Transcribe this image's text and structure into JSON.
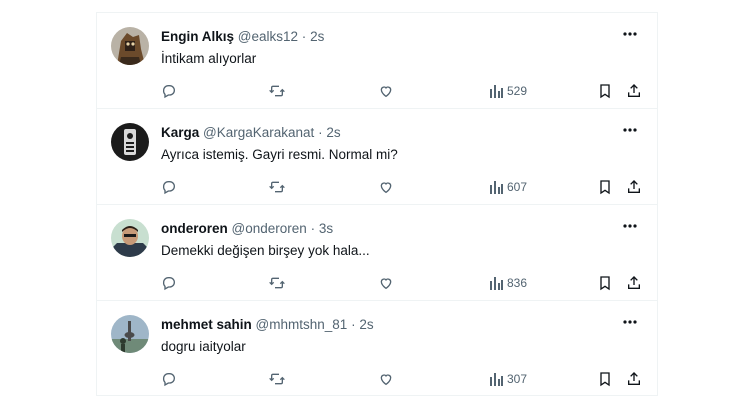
{
  "tweets": [
    {
      "name": "Engin Alkış",
      "handle": "@ealks12",
      "separator": "·",
      "time": "2s",
      "text": "İntikam alıyorlar",
      "views": "529"
    },
    {
      "name": "Karga",
      "handle": "@KargaKarakanat",
      "separator": "·",
      "time": "2s",
      "text": "Ayrıca istemiş. Gayri resmi. Normal mi?",
      "views": "607"
    },
    {
      "name": "onderoren",
      "handle": "@onderoren",
      "separator": "·",
      "time": "3s",
      "text": "Demekki değişen birşey yok hala...",
      "views": "836"
    },
    {
      "name": "mehmet sahin",
      "handle": "@mhmtshn_81",
      "separator": "·",
      "time": "2s",
      "text": "dogru iaityolar",
      "views": "307"
    }
  ],
  "icons": {
    "more": "more-horizontal-icon",
    "reply": "reply-icon",
    "retweet": "retweet-icon",
    "like": "heart-icon",
    "views": "bar-chart-icon",
    "bookmark": "bookmark-icon",
    "share": "share-icon"
  },
  "colors": {
    "text": "#0f1419",
    "secondary": "#536471",
    "border": "#eff3f4"
  }
}
